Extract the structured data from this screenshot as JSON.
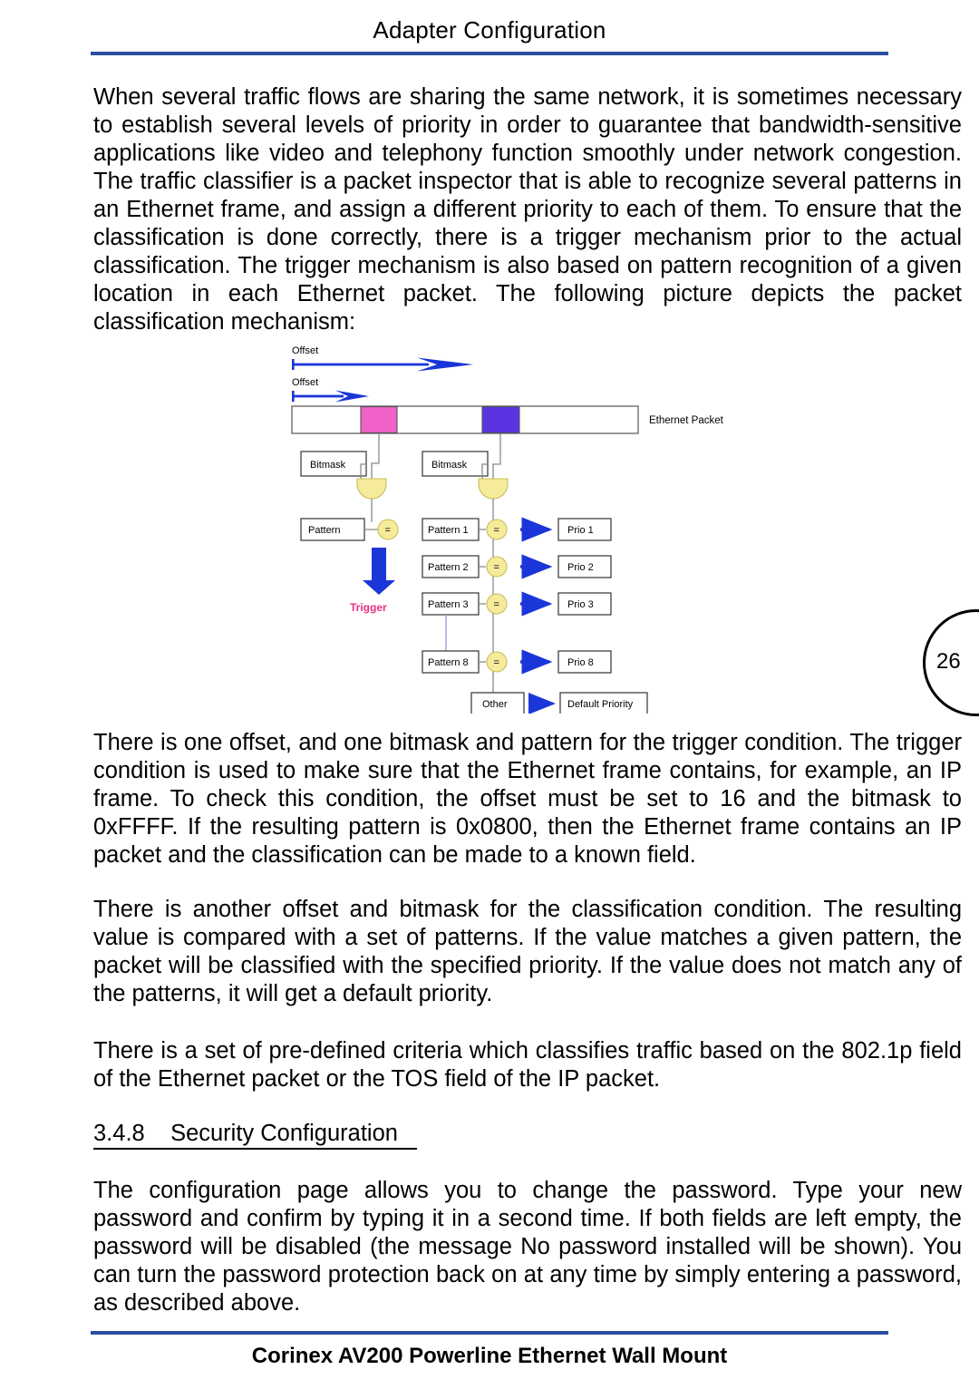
{
  "header": {
    "title": "Adapter Configuration",
    "rule_color": "#2b4ea2"
  },
  "footer": {
    "title": "Corinex AV200 Powerline Ethernet Wall Mount",
    "rule_color": "#2b4ea2"
  },
  "page_marker": {
    "number": "26"
  },
  "paragraphs": {
    "intro": "When several traffic flows are sharing the same network, it is sometimes necessary to establish several levels of priority in order to guarantee that bandwidth-sensitive applications like video and telephony function smoothly under network congestion. The traffic classifier is a packet inspector that is able to recognize several patterns in an Ethernet frame, and assign a different priority to each of them. To ensure that the classification is done correctly, there is a trigger mechanism prior to the actual classification. The trigger mechanism is also based on pattern recognition of a given location in each Ethernet packet. The following picture depicts the packet classification mechanism:",
    "trigger": "There is one offset, and one bitmask and pattern for the trigger condition. The trigger condition is used to make sure that the Ethernet frame contains, for example, an IP frame. To check this condition, the offset must be set to 16 and the bitmask to 0xFFFF. If the resulting pattern is 0x0800, then the Ethernet frame contains an IP packet and the classification can be made to a known field.",
    "classification": "There is another offset and bitmask for the classification condition. The resulting value is compared with a set of patterns. If the value matches a given pattern, the packet will be classified with the specified priority. If the value does not match any of the patterns, it will get a default priority.",
    "criteria": "There is a set of pre-defined criteria which classifies traffic based on the 802.1p field of the Ethernet packet or the TOS field of the IP packet.",
    "security": "The configuration page allows you to change the password. Type your new password and confirm by typing it in a second time. If both fields are left empty, the password will be disabled (the message No password installed  will be shown). You can turn the password protection back on at any time by simply entering a password, as described above."
  },
  "section": {
    "number": "3.4.8",
    "title": "Security Configuration"
  },
  "diagram": {
    "offset_top_label": "Offset",
    "offset_bottom_label": "Offset",
    "packet_label": "Ethernet Packet",
    "bitmask_left_label": "Bitmask",
    "bitmask_right_label": "Bitmask",
    "trigger_label": "Trigger",
    "trigger_pattern_label": "Pattern",
    "equals_symbol": "=",
    "other_label": "Other",
    "default_priority_label": "Default Priority",
    "patterns": [
      "Pattern 1",
      "Pattern 2",
      "Pattern 3",
      "Pattern 8"
    ],
    "priorities": [
      "Prio 1",
      "Prio 2",
      "Prio 3",
      "Prio 8"
    ],
    "colors": {
      "trigger_field": "#f062c8",
      "classify_field": "#5b33e0",
      "arrow": "#1a36d8",
      "gate": "#f5eb9b",
      "trigger_text": "#e8317f"
    }
  }
}
